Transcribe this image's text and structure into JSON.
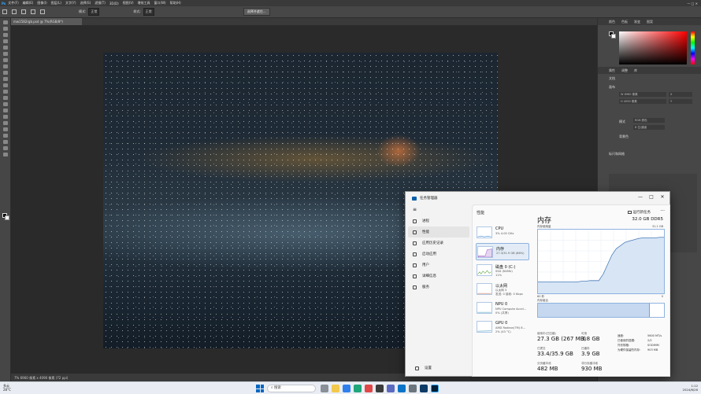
{
  "photoshop": {
    "menus": [
      "文件(F)",
      "编辑(E)",
      "图像(I)",
      "图层(L)",
      "文字(Y)",
      "选择(S)",
      "滤镜(T)",
      "3D(D)",
      "视图(V)",
      "增效工具",
      "窗口(W)",
      "帮助(H)"
    ],
    "options": {
      "mode_label": "模式:",
      "mode_value": "正常",
      "style_label": "样式:",
      "style_value": "正常",
      "select_mask": "选择并遮住..."
    },
    "doc_tab": "mw1582rgb.psd @ 7%(RGB/8*)",
    "status": "7%      6960 像素 x 4090 像素 (72 ppi)",
    "panels": {
      "top_tabs": [
        "颜色",
        "色板",
        "渐变",
        "图案"
      ],
      "properties_tabs": [
        "属性",
        "调整",
        "库"
      ],
      "doc_label": "文档",
      "canvas_label": "画布",
      "width_label": "W",
      "height_label": "H",
      "width_value": "6960 像素",
      "height_value": "4090 像素",
      "x_label": "X",
      "y_label": "Y",
      "mode_label": "模式",
      "mode_value": "RGB 颜色",
      "depth_value": "8 位/通道",
      "bg_label": "背景色",
      "rulers_label": "标尺和网格"
    }
  },
  "task_manager": {
    "title": "任务管理器",
    "controls": [
      "—",
      "□",
      "✕"
    ],
    "nav": [
      {
        "label": "进程",
        "selected": false
      },
      {
        "label": "性能",
        "selected": true
      },
      {
        "label": "应用历史记录",
        "selected": false
      },
      {
        "label": "启动应用",
        "selected": false
      },
      {
        "label": "用户",
        "selected": false
      },
      {
        "label": "详细信息",
        "selected": false
      },
      {
        "label": "服务",
        "selected": false
      }
    ],
    "settings_label": "设置",
    "header": "性能",
    "run_task": "运行新任务",
    "more": "···",
    "devices": [
      {
        "name": "CPU",
        "sub": "3%  4.00 GHz",
        "selected": false,
        "color": "#1a73c8"
      },
      {
        "name": "内存",
        "sub": "27.3/31.9 GB (86%)",
        "selected": true,
        "color": "#8a3ab9"
      },
      {
        "name": "磁盘 0 (C:)",
        "sub": "SSD (NVMe)\n11%",
        "selected": false,
        "color": "#4c9a2a"
      },
      {
        "name": "以太网",
        "sub": "以太网 3\n发送: 0 接收: 0 Kbps",
        "selected": false,
        "color": "#b4513c"
      },
      {
        "name": "NPU 0",
        "sub": "NPU Compute Accel...\n0% (共享)",
        "selected": false,
        "color": "#2c8fb5"
      },
      {
        "name": "GPU 0",
        "sub": "AMD Radeon(TM) 8...\n2% (43 °C)",
        "selected": false,
        "color": "#2c8fb5"
      }
    ],
    "memory": {
      "title": "内存",
      "total": "32.0 GB DDR5",
      "usage_label": "内存使用量",
      "max_label": "31.1 GB",
      "time_left": "60 秒",
      "time_right": "0",
      "composition_label": "内存组合",
      "usage_history": [
        0.18,
        0.18,
        0.18,
        0.18,
        0.18,
        0.18,
        0.18,
        0.18,
        0.18,
        0.18,
        0.19,
        0.19,
        0.2,
        0.2,
        0.2,
        0.3,
        0.45,
        0.6,
        0.7,
        0.75,
        0.8,
        0.82,
        0.84,
        0.86,
        0.87,
        0.87,
        0.87,
        0.87,
        0.88,
        0.88
      ],
      "composition_in_use": 0.885,
      "stats": [
        {
          "label": "使用中(已压缩)",
          "value": "27.3 GB (267 MB)"
        },
        {
          "label": "可用",
          "value": "3.8 GB"
        },
        {
          "label": "已提交",
          "value": "33.4/35.9 GB"
        },
        {
          "label": "已缓存",
          "value": "3.9 GB"
        },
        {
          "label": "分页缓冲池",
          "value": "482 MB"
        },
        {
          "label": "非分页缓冲池",
          "value": "930 MB"
        }
      ],
      "details": [
        {
          "label": "速度:",
          "value": "5600 MT/s"
        },
        {
          "label": "已使用的插槽:",
          "value": "2/2"
        },
        {
          "label": "外形规格:",
          "value": "SODIMM"
        },
        {
          "label": "为硬件保留的内存:",
          "value": "903 MB"
        }
      ]
    }
  },
  "taskbar": {
    "weather": "28°C",
    "weather_desc": "多云",
    "search_placeholder": "搜索",
    "time": "1:12",
    "date": "2024/6/26"
  }
}
